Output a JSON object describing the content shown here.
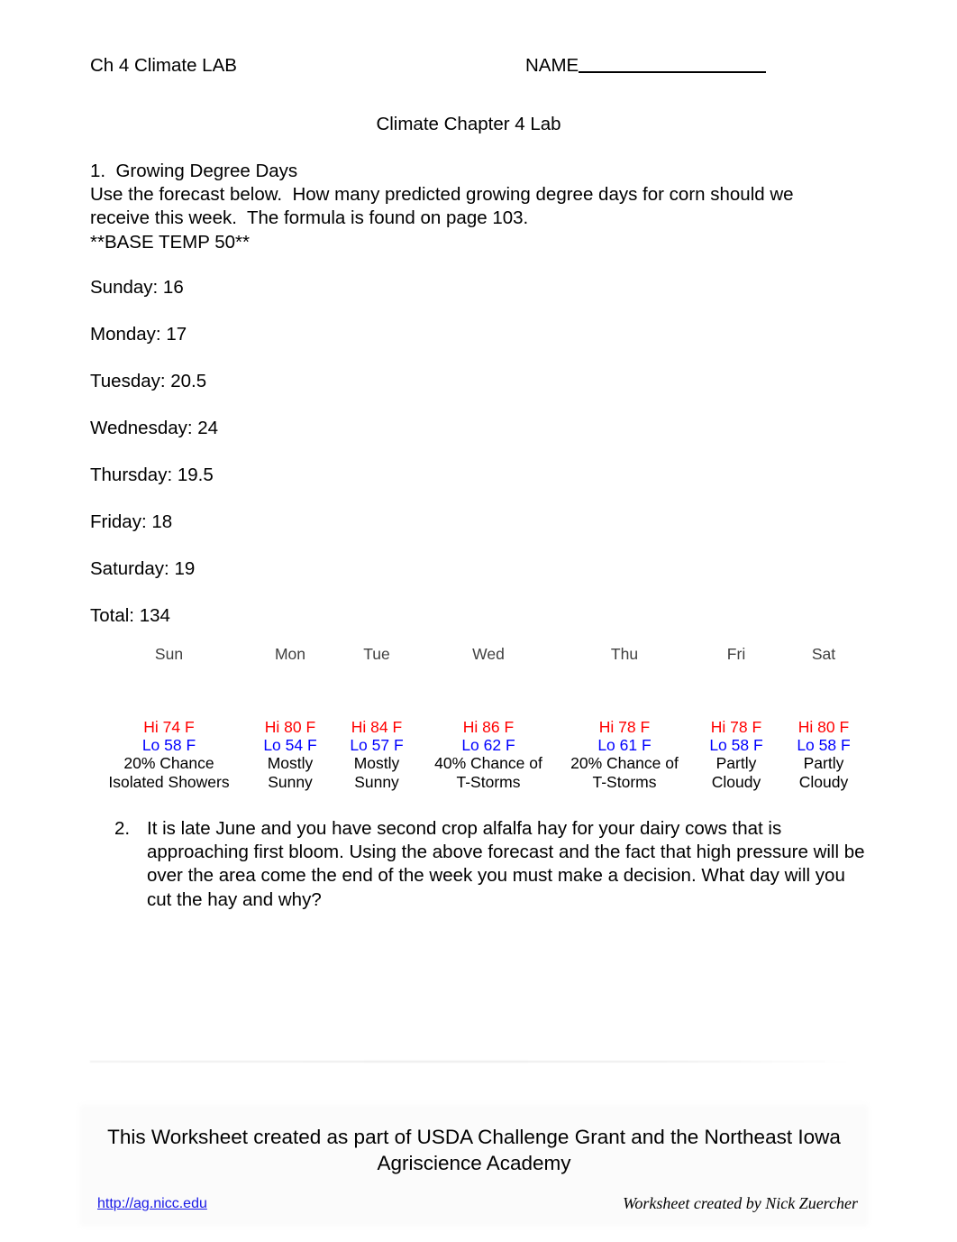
{
  "header": {
    "left_title": "Ch 4 Climate LAB",
    "name_label": "NAME"
  },
  "doc_title": "Climate Chapter 4 Lab",
  "question1": {
    "number_and_title": "1.  Growing Degree Days",
    "line2": "Use the forecast below.  How many predicted growing degree days for corn should we",
    "line3": "receive this week.  The formula is found on page 103.",
    "line4": "**BASE TEMP 50**"
  },
  "gdd_list": [
    {
      "label": "Sunday: 16"
    },
    {
      "label": "Monday: 17"
    },
    {
      "label": "Tuesday: 20.5"
    },
    {
      "label": "Wednesday: 24"
    },
    {
      "label": "Thursday: 19.5"
    },
    {
      "label": "Friday: 18"
    },
    {
      "label": "Saturday: 19"
    },
    {
      "label": "Total: 134"
    }
  ],
  "forecast": {
    "columns": [
      {
        "day": "Sun",
        "hi": "Hi 74 F",
        "lo": "Lo 58 F",
        "desc_line1": "20% Chance",
        "desc_line2": "Isolated Showers"
      },
      {
        "day": "Mon",
        "hi": "Hi 80 F",
        "lo": "Lo 54 F",
        "desc_line1": "Mostly",
        "desc_line2": "Sunny"
      },
      {
        "day": "Tue",
        "hi": "Hi 84 F",
        "lo": "Lo 57 F",
        "desc_line1": "Mostly",
        "desc_line2": "Sunny"
      },
      {
        "day": "Wed",
        "hi": "Hi 86 F",
        "lo": "Lo 62 F",
        "desc_line1": "40% Chance of",
        "desc_line2": "T-Storms"
      },
      {
        "day": "Thu",
        "hi": "Hi 78 F",
        "lo": "Lo 61 F",
        "desc_line1": "20% Chance of",
        "desc_line2": "T-Storms"
      },
      {
        "day": "Fri",
        "hi": "Hi 78 F",
        "lo": "Lo 58 F",
        "desc_line1": "Partly",
        "desc_line2": "Cloudy"
      },
      {
        "day": "Sat",
        "hi": "Hi 80 F",
        "lo": "Lo 58 F",
        "desc_line1": "Partly",
        "desc_line2": "Cloudy"
      }
    ],
    "hi_color": "#ff0000",
    "lo_color": "#0000ff",
    "header_color": "#404040"
  },
  "question2": {
    "number": "2.",
    "text": "It is late June and you have second crop alfalfa hay for your dairy cows that is approaching first bloom.  Using the above forecast and the fact that high pressure will be over the area come the end of the week you must make a decision.  What day will you cut the hay and why?"
  },
  "footer": {
    "heading": "This Worksheet created as part of USDA Challenge Grant and the Northeast Iowa Agriscience Academy",
    "link": "http://ag.nicc.edu",
    "link_color": "#1a1ae6",
    "credit": "Worksheet created by Nick Zuercher"
  }
}
